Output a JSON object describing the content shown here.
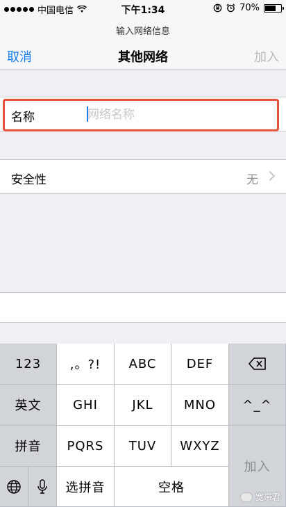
{
  "status_bar": {
    "carrier": "中国电信",
    "time": "下午1:34",
    "battery_text": "70%",
    "battery_level": 0.7,
    "signal_icon": "signal-dots-icon",
    "wifi_icon": "wifi-icon",
    "lock_icon": "rotation-lock-icon",
    "alarm_icon": "alarm-icon"
  },
  "nav": {
    "prompt": "输入网络信息",
    "cancel_label": "取消",
    "title": "其他网络",
    "add_label": "加入"
  },
  "form": {
    "name_label": "名称",
    "name_value": "",
    "name_placeholder": "网络名称",
    "security_label": "安全性",
    "security_value": "无"
  },
  "keyboard": {
    "row1": [
      "123",
      ",。?!",
      "ABC",
      "DEF"
    ],
    "row2": [
      "英文",
      "GHI",
      "JKL",
      "MNO",
      "^_^"
    ],
    "row3": [
      "拼音",
      "PQRS",
      "TUV",
      "WXYZ"
    ],
    "row4": [
      "选拼音",
      "空格"
    ],
    "return_label": "加入",
    "delete_icon": "backspace-icon",
    "globe_icon": "globe-icon",
    "mic_icon": "microphone-icon"
  },
  "watermark": {
    "text": "宽带君"
  },
  "colors": {
    "accent": "#1a7ef3",
    "highlight": "#e5533d"
  }
}
